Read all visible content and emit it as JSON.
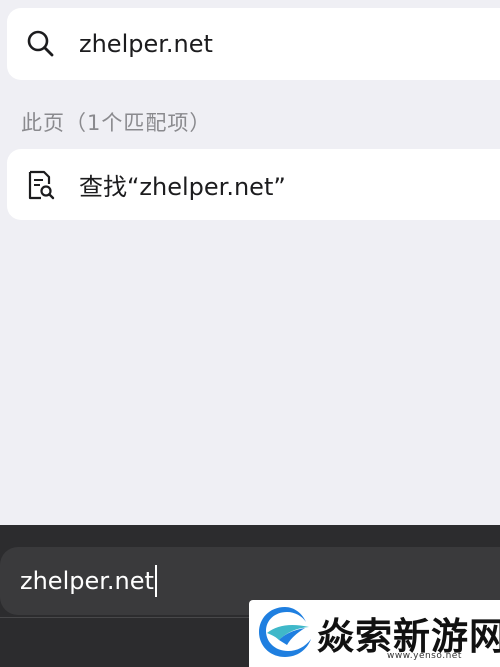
{
  "suggestion": {
    "icon": "search-icon",
    "text": "zhelper.net"
  },
  "section": {
    "label": "此页（1个匹配项）"
  },
  "find_on_page": {
    "icon": "find-in-page-icon",
    "text": "查找“zhelper.net”"
  },
  "address_bar": {
    "value": "zhelper.net"
  },
  "watermark": {
    "text": "焱索新游网",
    "subtext": "www.yenso.net"
  },
  "colors": {
    "background": "#efeff4",
    "card": "#ffffff",
    "label": "#8a8a8e",
    "bottom_bar": "#2c2c2e",
    "address_field": "#3a3a3c",
    "logo_blue": "#1f7fe0",
    "logo_teal": "#3fb8c9"
  }
}
